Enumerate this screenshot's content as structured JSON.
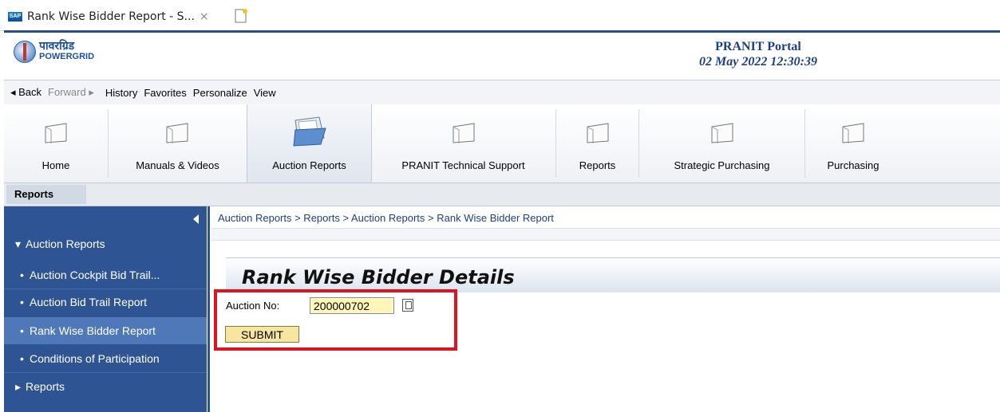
{
  "browser": {
    "tab_title": "Rank Wise Bidder Report - S...",
    "close": "×",
    "sap_badge": "SAP"
  },
  "header": {
    "logo_hindi": "पावरग्रिड",
    "logo_english": "POWERGRID",
    "portal_title": "PRANIT Portal",
    "datetime": "02 May 2022  12:30:39"
  },
  "nav": {
    "back": "◂ Back",
    "forward": "Forward ▸",
    "history": "History",
    "favorites": "Favorites",
    "personalize": "Personalize",
    "view": "View"
  },
  "toolbar": {
    "items": [
      {
        "label": "Home"
      },
      {
        "label": "Manuals & Videos"
      },
      {
        "label": "Auction Reports"
      },
      {
        "label": "PRANIT Technical Support"
      },
      {
        "label": "Reports"
      },
      {
        "label": "Strategic Purchasing"
      },
      {
        "label": "Purchasing"
      }
    ]
  },
  "subtab": {
    "label": "Reports"
  },
  "sidebar": {
    "group1": "Auction Reports",
    "items": [
      {
        "label": "Auction Cockpit Bid Trail..."
      },
      {
        "label": "Auction Bid Trail Report"
      },
      {
        "label": "Rank Wise Bidder Report"
      },
      {
        "label": "Conditions of Participation"
      }
    ],
    "group2": "Reports"
  },
  "main": {
    "breadcrumb": "Auction Reports  >  Reports  >  Auction Reports  >  Rank Wise Bidder Report",
    "title": "Rank Wise Bidder Details",
    "auction_label": "Auction No:",
    "auction_value": "200000702",
    "submit_label": "SUBMIT"
  },
  "colors": {
    "sidebar_bg": "#2f5494",
    "sidebar_selected": "#4e78b8",
    "highlight_box": "#e0141e",
    "input_bg": "#fff6b8",
    "button_bg": "#f6e6a0"
  }
}
